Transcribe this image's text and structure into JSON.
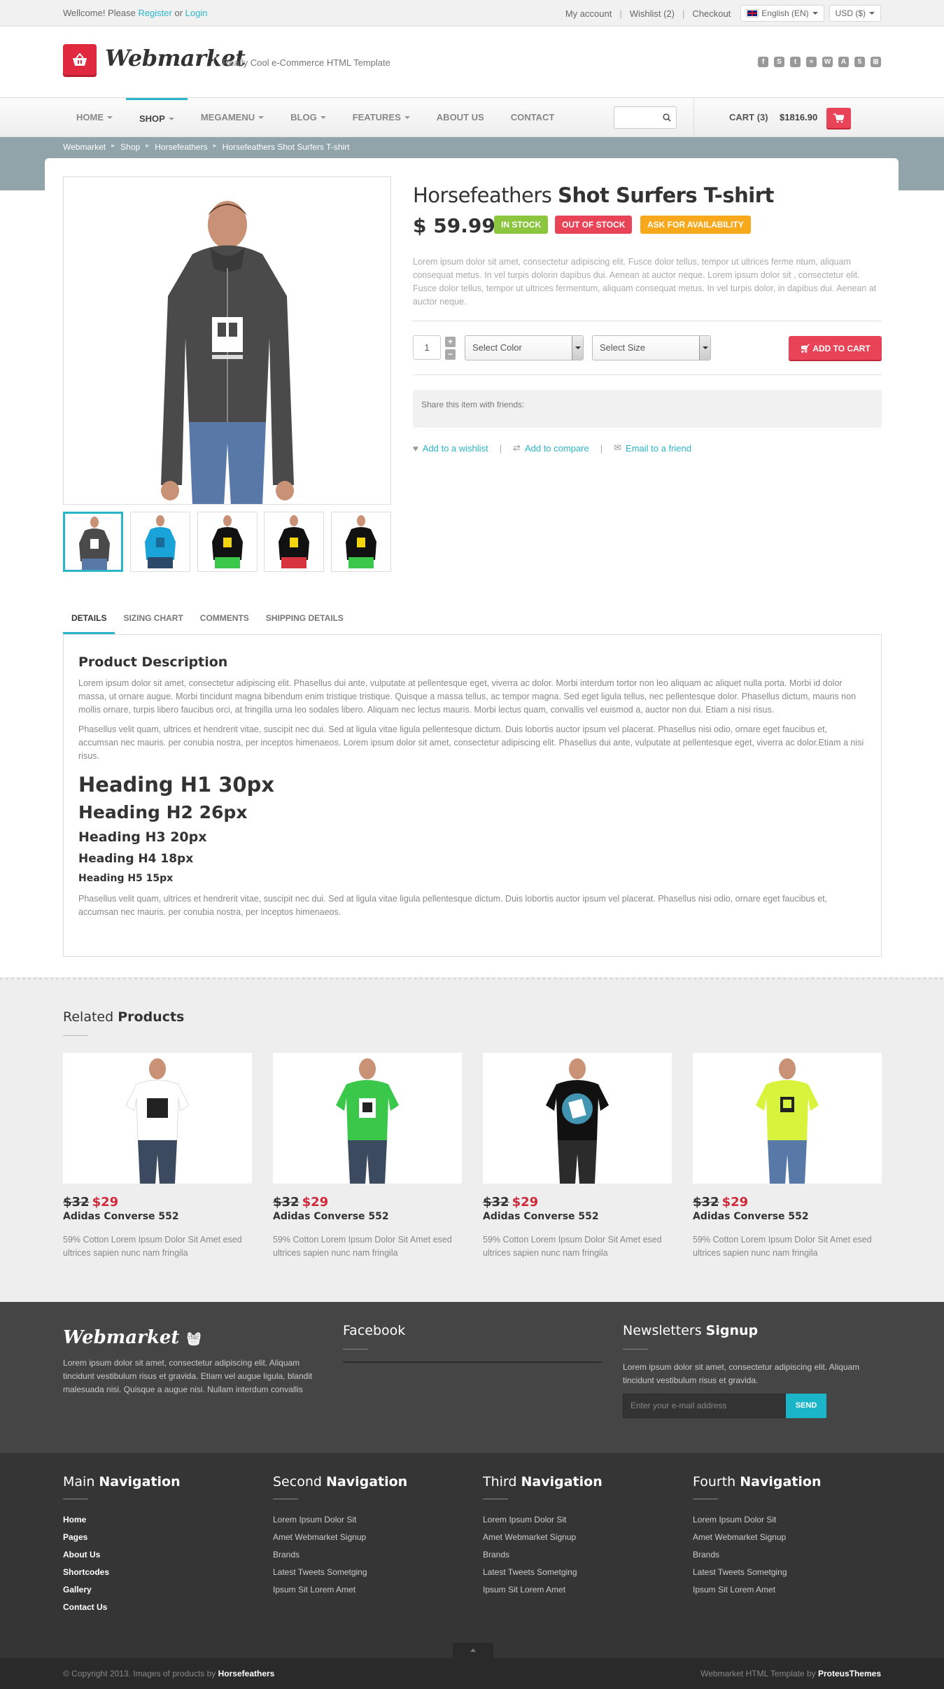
{
  "topbar": {
    "welcome": "Wellcome! Please",
    "register": "Register",
    "or": "or",
    "login": "Login",
    "my_account": "My account",
    "wishlist": "Wishlist (2)",
    "checkout": "Checkout",
    "language": "English (EN)",
    "currency": "USD ($)"
  },
  "header": {
    "logo_text": "Webmarket",
    "tagline": "Really Cool e-Commerce HTML Template",
    "social_icons": [
      "facebook-icon",
      "skype-icon",
      "twitter-icon",
      "rss-icon",
      "wordpress-icon",
      "android-icon",
      "html5-icon",
      "windows-icon"
    ]
  },
  "nav": {
    "items": [
      "HOME",
      "SHOP",
      "MEGAMENU",
      "BLOG",
      "FEATURES",
      "ABOUT US",
      "CONTACT"
    ],
    "cart_label": "CART (3)",
    "cart_total": "$1816.90"
  },
  "breadcrumb": [
    "Webmarket",
    "Shop",
    "Horsefeathers",
    "Horsefeathers Shot Surfers T-shirt"
  ],
  "product": {
    "brand": "Horsefeathers",
    "name": "Shot Surfers T-shirt",
    "price": "$ 59.99",
    "badges": {
      "in_stock": "IN STOCK",
      "out_of_stock": "OUT OF STOCK",
      "ask": "ASK FOR AVAILABILITY"
    },
    "description": "Lorem ipsum dolor sit amet, consectetur adipiscing elit. Fusce dolor tellus, tempor ut ultrices ferme ntum, aliquam consequat metus. In vel turpis dolorin dapibus dui. Aenean at auctor neque. Lorem ipsum dolor sit , consectetur elit. Fusce dolor tellus, tempor ut ultrices fermentum, aliquam consequat metus. In vel turpis dolor, in dapibus dui. Aenean at auctor neque.",
    "quantity": "1",
    "color_select": "Select Color",
    "size_select": "Select Size",
    "add_to_cart": "ADD TO CART",
    "share_text": "Share this item with friends:",
    "actions": {
      "wishlist": "Add to a wishlist",
      "compare": "Add to compare",
      "email": "Email to a friend"
    },
    "colors": {
      "accent": "#2bb5c9",
      "red": "#e84357",
      "green": "#8cc63f",
      "orange": "#f7a81b"
    }
  },
  "tabs": [
    "DETAILS",
    "SIZING CHART",
    "COMMENTS",
    "SHIPPING DETAILS"
  ],
  "details": {
    "title": "Product Description",
    "p1": "Lorem ipsum dolor sit amet, consectetur adipiscing elit. Phasellus dui ante, vulputate at pellentesque eget, viverra ac dolor. Morbi interdum tortor non leo aliquam ac aliquet nulla porta. Morbi id dolor massa, ut ornare augue. Morbi tincidunt magna bibendum enim tristique tristique. Quisque a massa tellus, ac tempor magna. Sed eget ligula tellus, nec pellentesque dolor. Phasellus dictum, mauris non mollis ornare, turpis libero faucibus orci, at fringilla urna leo sodales libero. Aliquam nec lectus mauris. Morbi lectus quam, convallis vel euismod a, auctor non dui. Etiam a nisi risus.",
    "p2": "Phasellus velit quam, ultrices et hendrerit vitae, suscipit nec dui. Sed at ligula vitae ligula pellentesque dictum. Duis lobortis auctor ipsum vel placerat. Phasellus nisi odio, ornare eget faucibus et, accumsan nec mauris. per conubia nostra, per inceptos himenaeos. Lorem ipsum dolor sit amet, consectetur adipiscing elit. Phasellus dui ante, vulputate at pellentesque eget, viverra ac dolor.Etiam a nisi risus.",
    "h1": "Heading H1 30px",
    "h2": "Heading H2 26px",
    "h3": "Heading H3 20px",
    "h4": "Heading H4 18px",
    "h5": "Heading H5 15px",
    "p3": "Phasellus velit quam, ultrices et hendrerit vitae, suscipit nec dui. Sed at ligula vitae ligula pellentesque dictum. Duis lobortis auctor ipsum vel placerat. Phasellus nisi odio, ornare eget faucibus et, accumsan nec mauris. per conubia nostra, per inceptos himenaeos."
  },
  "related": {
    "title_light": "Related",
    "title_bold": "Products",
    "items": [
      {
        "old_price": "$32",
        "price": "$29",
        "name": "Adidas Converse 552",
        "desc": "59% Cotton Lorem Ipsum Dolor Sit Amet esed ultrices sapien nunc nam fringila",
        "shirt": "#ffffff"
      },
      {
        "old_price": "$32",
        "price": "$29",
        "name": "Adidas Converse 552",
        "desc": "59% Cotton Lorem Ipsum Dolor Sit Amet esed ultrices sapien nunc nam fringila",
        "shirt": "#3bc84a"
      },
      {
        "old_price": "$32",
        "price": "$29",
        "name": "Adidas Converse 552",
        "desc": "59% Cotton Lorem Ipsum Dolor Sit Amet esed ultrices sapien nunc nam fringila",
        "shirt": "#111111"
      },
      {
        "old_price": "$32",
        "price": "$29",
        "name": "Adidas Converse 552",
        "desc": "59% Cotton Lorem Ipsum Dolor Sit Amet esed ultrices sapien nunc nam fringila",
        "shirt": "#d8f33c"
      }
    ]
  },
  "footer": {
    "logo_text": "Webmarket",
    "about": "Lorem ipsum dolor sit amet, consectetur adipiscing elit. Aliquam tincidunt vestibulum risus et gravida. Etiam vel augue ligula, blandit malesuada nisi. Quisque a augue nisi. Nullam interdum convallis",
    "facebook_title": "Facebook",
    "newsletter_light": "Newsletters",
    "newsletter_bold": "Signup",
    "newsletter_text": "Lorem ipsum dolor sit amet, consectetur adipiscing elit. Aliquam tincidunt vestibulum risus et gravida.",
    "email_placeholder": "Enter your e-mail address",
    "send": "SEND",
    "columns": [
      {
        "light": "Main",
        "bold": "Navigation",
        "links": [
          "Home",
          "Pages",
          "About Us",
          "Shortcodes",
          "Gallery",
          "Contact Us"
        ]
      },
      {
        "light": "Second",
        "bold": "Navigation",
        "links": [
          "Lorem Ipsum Dolor Sit",
          "Amet Webmarket Signup",
          "Brands",
          "Latest Tweets Sometging",
          "Ipsum Sit Lorem Amet"
        ]
      },
      {
        "light": "Third",
        "bold": "Navigation",
        "links": [
          "Lorem Ipsum Dolor Sit",
          "Amet Webmarket Signup",
          "Brands",
          "Latest Tweets Sometging",
          "Ipsum Sit Lorem Amet"
        ]
      },
      {
        "light": "Fourth",
        "bold": "Navigation",
        "links": [
          "Lorem Ipsum Dolor Sit",
          "Amet Webmarket Signup",
          "Brands",
          "Latest Tweets Sometging",
          "Ipsum Sit Lorem Amet"
        ]
      }
    ],
    "copyright": "© Copyright 2013. Images of products by",
    "copyright_brand": "Horsefeathers",
    "credit": "Webmarket HTML Template by",
    "credit_brand": "ProteusThemes"
  }
}
